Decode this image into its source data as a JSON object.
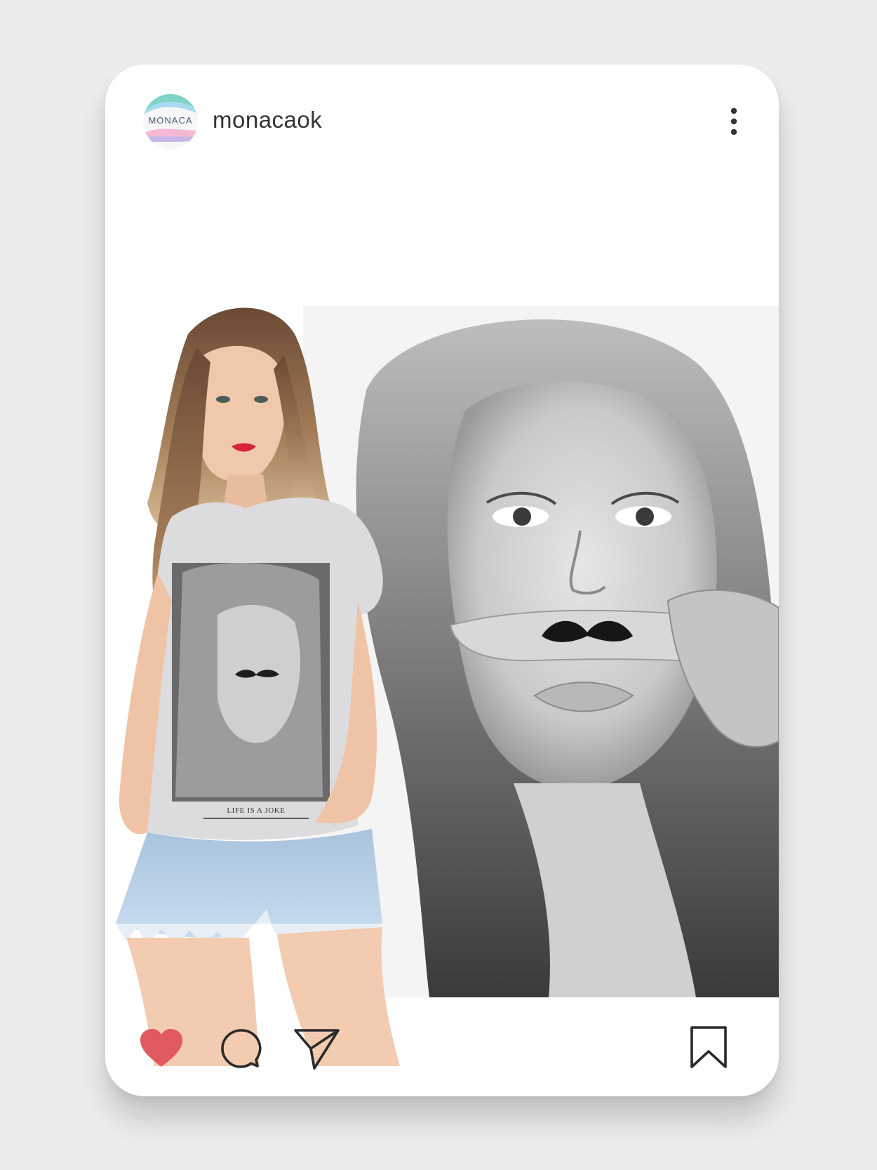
{
  "post": {
    "username": "monacaok",
    "avatar_text": "MONACA",
    "more_icon": "more-vertical-icon",
    "shirt_caption": "LIFE IS A JOKE"
  },
  "actions": {
    "like_icon": "heart-filled-icon",
    "comment_icon": "comment-bubble-icon",
    "share_icon": "paper-plane-icon",
    "save_icon": "bookmark-icon",
    "liked": true
  },
  "colors": {
    "like": "#e05a5f",
    "icon_stroke": "#2a2a2a",
    "avatar_top": "#7fd3c7",
    "avatar_mid": "#a7dcf0",
    "avatar_bottom": "#f4b8d4"
  }
}
